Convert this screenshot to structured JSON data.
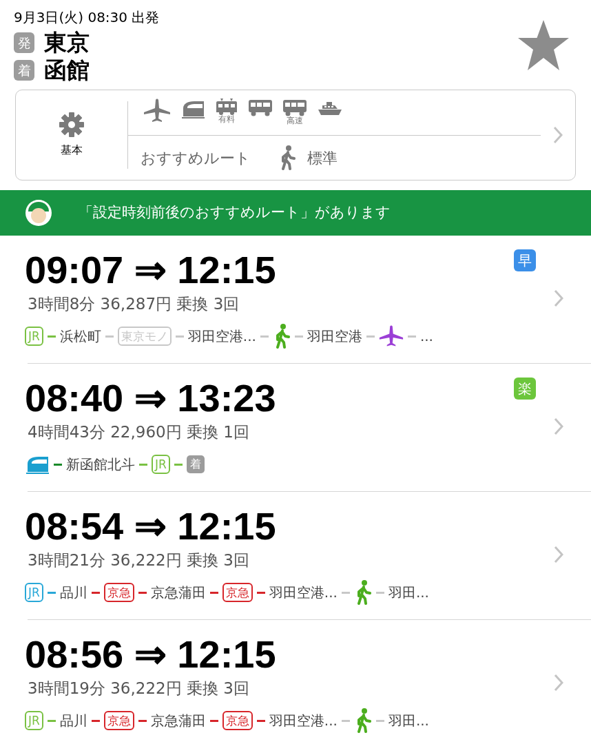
{
  "header": {
    "departure_info": "9月3日(火) 08:30 出発",
    "from_label": "発",
    "from": "東京",
    "to_label": "着",
    "to": "函館"
  },
  "settings": {
    "label": "基本",
    "modes": [
      {
        "kind": "plane"
      },
      {
        "kind": "shinkansen"
      },
      {
        "kind": "tram",
        "label": "有料"
      },
      {
        "kind": "bus"
      },
      {
        "kind": "bus",
        "label": "高速"
      },
      {
        "kind": "ship"
      }
    ],
    "route_type": "おすすめルート",
    "walk_speed": "標準"
  },
  "notice": {
    "text": "「設定時刻前後のおすすめルート」があります"
  },
  "routes": [
    {
      "time": "09:07 ⇒ 12:15",
      "summary": "3時間8分  36,287円  乗換 3回",
      "tag": {
        "text": "早",
        "color": "#3b8fe8"
      },
      "segments": [
        {
          "kind": "line",
          "text": "JR",
          "color": "#7ac143"
        },
        {
          "kind": "dash",
          "color": "#7ac143"
        },
        {
          "kind": "station",
          "text": "浜松町"
        },
        {
          "kind": "dash",
          "color": "#c8c8c8"
        },
        {
          "kind": "line",
          "text": "東京モノ",
          "color": "#c8c8c8"
        },
        {
          "kind": "dash",
          "color": "#c8c8c8"
        },
        {
          "kind": "station",
          "text": "羽田空港..."
        },
        {
          "kind": "dash",
          "color": "#c8c8c8"
        },
        {
          "kind": "walk",
          "color": "#4cae1e"
        },
        {
          "kind": "dash",
          "color": "#c8c8c8"
        },
        {
          "kind": "station",
          "text": "羽田空港"
        },
        {
          "kind": "dash",
          "color": "#c8c8c8"
        },
        {
          "kind": "plane",
          "color": "#9b3fd6"
        },
        {
          "kind": "dash",
          "color": "#c8c8c8"
        },
        {
          "kind": "station",
          "text": "..."
        }
      ]
    },
    {
      "time": "08:40 ⇒ 13:23",
      "summary": "4時間43分  22,960円  乗換 1回",
      "tag": {
        "text": "楽",
        "color": "#6cc63c"
      },
      "segments": [
        {
          "kind": "shinkansen",
          "color": "#1a9fcf"
        },
        {
          "kind": "dash",
          "color": "#1a8a2a"
        },
        {
          "kind": "station",
          "text": "新函館北斗"
        },
        {
          "kind": "dash",
          "color": "#7ac143"
        },
        {
          "kind": "line",
          "text": "JR",
          "color": "#7ac143"
        },
        {
          "kind": "dash",
          "color": "#7ac143"
        },
        {
          "kind": "end",
          "text": "着"
        }
      ]
    },
    {
      "time": "08:54 ⇒ 12:15",
      "summary": "3時間21分  36,222円  乗換 3回",
      "segments": [
        {
          "kind": "line",
          "text": "JR",
          "color": "#29a8d8"
        },
        {
          "kind": "dash",
          "color": "#29a8d8"
        },
        {
          "kind": "station",
          "text": "品川"
        },
        {
          "kind": "dash",
          "color": "#d7262b"
        },
        {
          "kind": "line",
          "text": "京急",
          "color": "#d7262b"
        },
        {
          "kind": "dash",
          "color": "#d7262b"
        },
        {
          "kind": "station",
          "text": "京急蒲田"
        },
        {
          "kind": "dash",
          "color": "#d7262b"
        },
        {
          "kind": "line",
          "text": "京急",
          "color": "#d7262b"
        },
        {
          "kind": "dash",
          "color": "#d7262b"
        },
        {
          "kind": "station",
          "text": "羽田空港..."
        },
        {
          "kind": "dash",
          "color": "#c8c8c8"
        },
        {
          "kind": "walk",
          "color": "#4cae1e"
        },
        {
          "kind": "dash",
          "color": "#c8c8c8"
        },
        {
          "kind": "station",
          "text": "羽田..."
        }
      ]
    },
    {
      "time": "08:56 ⇒ 12:15",
      "summary": "3時間19分  36,222円  乗換 3回",
      "segments": [
        {
          "kind": "line",
          "text": "JR",
          "color": "#7ac143"
        },
        {
          "kind": "dash",
          "color": "#7ac143"
        },
        {
          "kind": "station",
          "text": "品川"
        },
        {
          "kind": "dash",
          "color": "#d7262b"
        },
        {
          "kind": "line",
          "text": "京急",
          "color": "#d7262b"
        },
        {
          "kind": "dash",
          "color": "#d7262b"
        },
        {
          "kind": "station",
          "text": "京急蒲田"
        },
        {
          "kind": "dash",
          "color": "#d7262b"
        },
        {
          "kind": "line",
          "text": "京急",
          "color": "#d7262b"
        },
        {
          "kind": "dash",
          "color": "#d7262b"
        },
        {
          "kind": "station",
          "text": "羽田空港..."
        },
        {
          "kind": "dash",
          "color": "#c8c8c8"
        },
        {
          "kind": "walk",
          "color": "#4cae1e"
        },
        {
          "kind": "dash",
          "color": "#c8c8c8"
        },
        {
          "kind": "station",
          "text": "羽田..."
        }
      ]
    }
  ]
}
